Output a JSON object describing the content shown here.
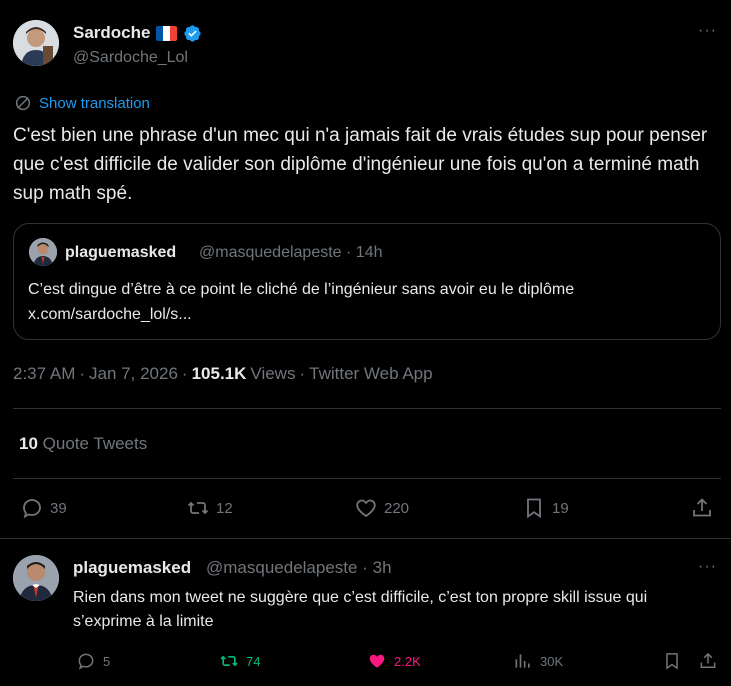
{
  "tweet": {
    "author_name": "Sardoche",
    "author_handle": "@Sardoche_Lol",
    "show_translation": "Show translation",
    "text": "C'est bien une phrase d'un mec qui n'a jamais fait de vrais études sup pour penser que c'est difficile de valider son diplôme d'ingénieur une fois qu'on a terminé math sup math spé.",
    "time": "2:37 AM",
    "date": "Jan 7, 2026",
    "views_count": "105.1K",
    "views_label": "Views",
    "client": "Twitter Web App",
    "quote_tweets_count": "10",
    "quote_tweets_label": "Quote Tweets",
    "actions": {
      "replies": "39",
      "retweets": "12",
      "likes": "220",
      "bookmarks": "19"
    }
  },
  "quoted": {
    "author_name": "plaguemasked",
    "author_handle": "@masquedelapeste",
    "age": "14h",
    "text_line1": "C’est dingue d’être à ce point le cliché de l’ingénieur sans avoir eu le diplôme",
    "text_line2": "x.com/sardoche_lol/s..."
  },
  "reply": {
    "author_name": "plaguemasked",
    "author_handle": "@masquedelapeste",
    "age": "3h",
    "text": "Rien dans mon tweet ne suggère que c’est difficile, c’est ton propre skill issue qui s’exprime à la limite",
    "actions": {
      "replies": "5",
      "retweets": "74",
      "likes": "2.2K",
      "views": "30K"
    }
  },
  "colors": {
    "background": "#000000",
    "text": "#e7e9ea",
    "muted": "#71767b",
    "accent": "#1d9bf0",
    "retweeted": "#00ba7c",
    "liked": "#f91880",
    "border": "#2f3336"
  },
  "icons": [
    "verified-badge-icon",
    "france-flag-icon",
    "more-icon",
    "translate-icon",
    "reply-icon",
    "retweet-icon",
    "like-icon",
    "bookmark-icon",
    "share-icon",
    "views-icon"
  ],
  "separators": {
    "dot": "·",
    "more": "···"
  }
}
